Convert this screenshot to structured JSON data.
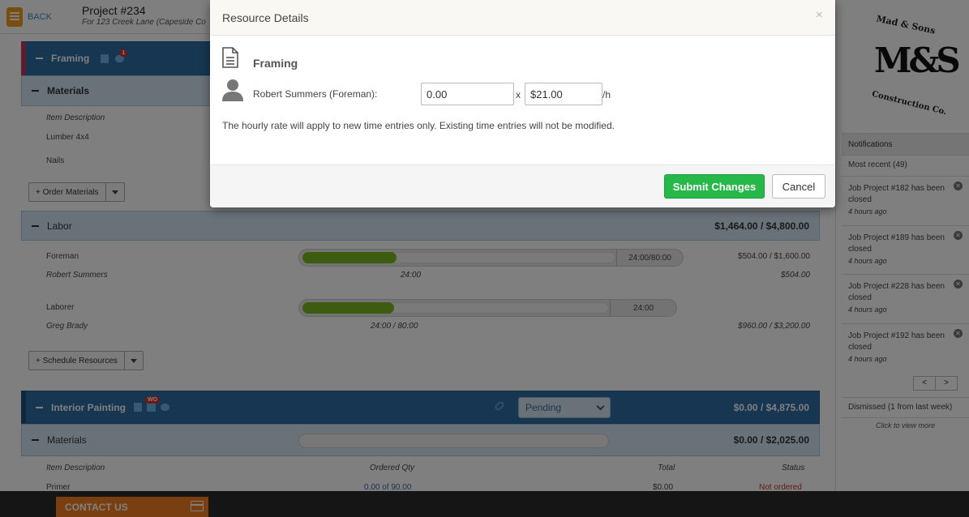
{
  "header": {
    "back_label": "BACK",
    "project_title": "Project #234",
    "project_subtitle": "For 123 Creek Lane (Capeside Co"
  },
  "framing": {
    "title": "Framing",
    "badge": "1",
    "materials": {
      "title": "Materials",
      "col_item_description": "Item Description",
      "items": [
        "Lumber 4x4",
        "Nails"
      ],
      "order_button": "+ Order Materials"
    },
    "labor": {
      "title": "Labor",
      "total": "$1,464.00 / $4,800.00",
      "rows": [
        {
          "role": "Foreman",
          "person": "Robert Summers",
          "progress_tag": "24:00/80:00",
          "hours": "24:00",
          "amount": "$504.00 / $1,600.00",
          "person_amount": "$504.00",
          "progress": 0.3
        },
        {
          "role": "Laborer",
          "person": "Greg Brady",
          "progress_tag": "24:00",
          "hours": "24:00 / 80:00",
          "amount": "$960.00 / $3,200.00",
          "person_amount": "",
          "progress": 0.3
        }
      ],
      "schedule_button": "+ Schedule Resources"
    }
  },
  "interior_painting": {
    "title": "Interior Painting",
    "badge": "WO",
    "status_select": "Pending",
    "total": "$0.00 / $4,875.00",
    "materials": {
      "title": "Materials",
      "total": "$0.00 / $2,025.00",
      "columns": [
        "Item Description",
        "Ordered Qty",
        "Total",
        "Status"
      ],
      "rows": [
        {
          "item": "Primer",
          "qty": "0.00 of 90.00",
          "total": "$0.00",
          "status": "Not ordered"
        }
      ]
    }
  },
  "sidebar": {
    "logo_top": "Mad & Sons",
    "logo_mark": "M&S",
    "logo_bottom": "Construction Co.",
    "notifications_title": "Notifications",
    "most_recent": "Most recent (49)",
    "items": [
      {
        "text": "Job Project #182 has been closed",
        "time": "4 hours ago"
      },
      {
        "text": "Job Project #189 has been closed",
        "time": "4 hours ago"
      },
      {
        "text": "Job Project #228 has been closed",
        "time": "4 hours ago"
      },
      {
        "text": "Job Project #192 has been closed",
        "time": "4 hours ago"
      }
    ],
    "prev": "<",
    "next": ">",
    "dismissed": "Dismissed (1 from last week)",
    "click_to_view": "Click to view more"
  },
  "footer": {
    "contact_label": "CONTACT US"
  },
  "modal": {
    "title": "Resource Details",
    "close": "×",
    "section_title": "Framing",
    "resource_label": "Robert Summers (Foreman):",
    "quantity_value": "0.00",
    "multiplier": "x",
    "rate_value": "$21.00",
    "rate_unit": "/h",
    "note": "The hourly rate will apply to new time entries only. Existing time entries will not be modified.",
    "submit_label": "Submit Changes",
    "cancel_label": "Cancel"
  },
  "colors": {
    "section_dark": "#2e6da4",
    "section_light": "#d5e5f2",
    "progress_green": "#7bb81e",
    "submit_green": "#27b84a",
    "contact_orange": "#f57f20",
    "status_red": "#c0392b"
  }
}
